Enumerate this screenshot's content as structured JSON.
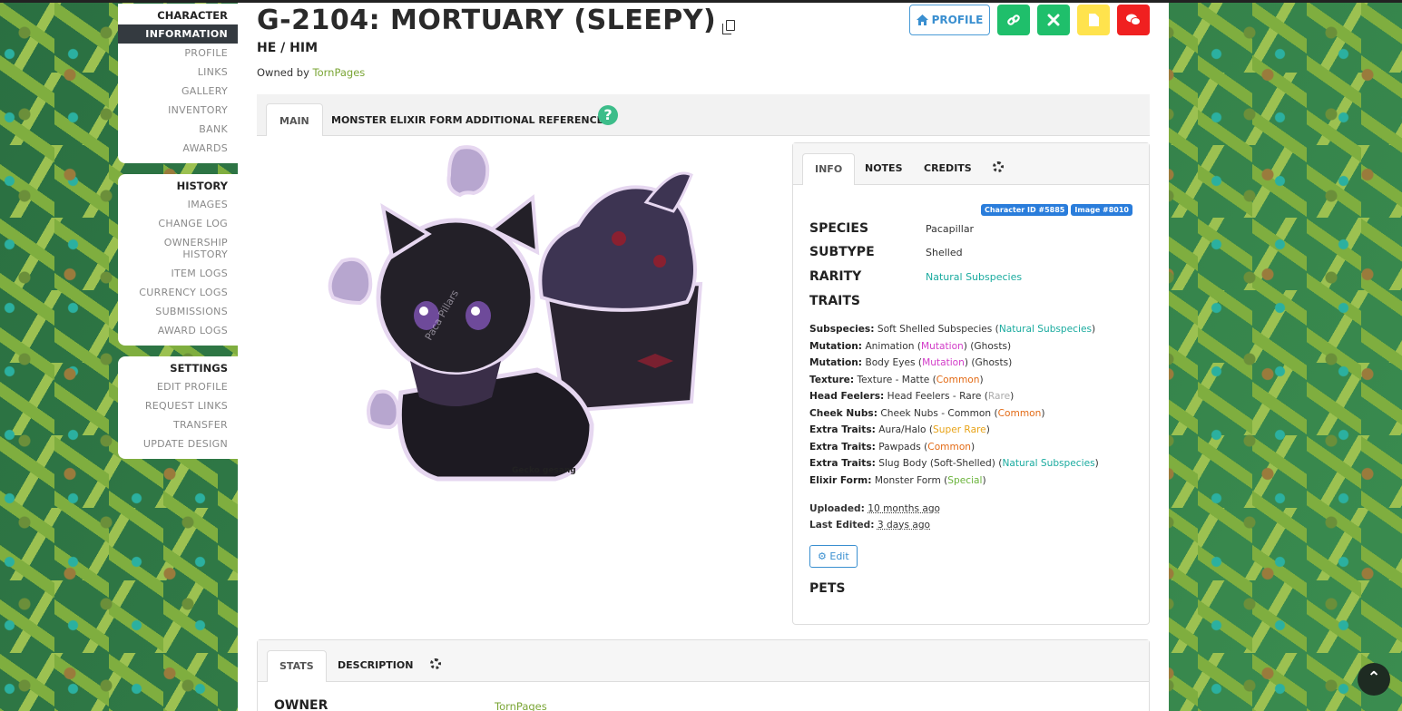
{
  "sidebar": {
    "sections": [
      {
        "heading": "CHARACTER",
        "items": [
          "INFORMATION",
          "PROFILE",
          "LINKS",
          "GALLERY",
          "INVENTORY",
          "BANK",
          "AWARDS"
        ]
      },
      {
        "heading": "HISTORY",
        "items": [
          "IMAGES",
          "CHANGE LOG",
          "OWNERSHIP HISTORY",
          "ITEM LOGS",
          "CURRENCY LOGS",
          "SUBMISSIONS",
          "AWARD LOGS"
        ]
      },
      {
        "heading": "SETTINGS",
        "items": [
          "EDIT PROFILE",
          "REQUEST LINKS",
          "TRANSFER",
          "UPDATE DESIGN"
        ]
      }
    ],
    "active_item": "INFORMATION"
  },
  "header": {
    "title": "G-2104: MORTUARY (SLEEPY)",
    "pronouns": "HE / HIM",
    "owned_prefix": "Owned by",
    "owner": "TornPages",
    "profile_button": "PROFILE"
  },
  "main_tabs": [
    "MAIN",
    "MONSTER ELIXIR FORM",
    "ADDITIONAL REFERENCE"
  ],
  "art": {
    "signature_text": "Gecko gesang",
    "watermark": "Paca Pillars"
  },
  "info": {
    "tabs": [
      "INFO",
      "NOTES",
      "CREDITS"
    ],
    "character_id": "Character ID #5885",
    "image_id": "Image #8010",
    "species_label": "SPECIES",
    "species": "Pacapillar",
    "subtype_label": "SUBTYPE",
    "subtype": "Shelled",
    "rarity_label": "RARITY",
    "rarity": "Natural Subspecies",
    "traits_label": "TRAITS",
    "traits": [
      {
        "cat": "Subspecies:",
        "name": "Soft Shelled Subspecies",
        "rarity": "Natural Subspecies",
        "color": "teal",
        "extra": ""
      },
      {
        "cat": "Mutation:",
        "name": "Animation",
        "rarity": "Mutation",
        "color": "pink",
        "extra": " (Ghosts)"
      },
      {
        "cat": "Mutation:",
        "name": "Body Eyes",
        "rarity": "Mutation",
        "color": "pink",
        "extra": " (Ghosts)"
      },
      {
        "cat": "Texture:",
        "name": "Texture - Matte",
        "rarity": "Common",
        "color": "orange",
        "extra": ""
      },
      {
        "cat": "Head Feelers:",
        "name": "Head Feelers - Rare",
        "rarity": "Rare",
        "color": "gray",
        "extra": ""
      },
      {
        "cat": "Cheek Nubs:",
        "name": "Cheek Nubs - Common",
        "rarity": "Common",
        "color": "orange",
        "extra": ""
      },
      {
        "cat": "Extra Traits:",
        "name": "Aura/Halo",
        "rarity": "Super Rare",
        "color": "gold",
        "extra": ""
      },
      {
        "cat": "Extra Traits:",
        "name": "Pawpads",
        "rarity": "Common",
        "color": "orange",
        "extra": ""
      },
      {
        "cat": "Extra Traits:",
        "name": "Slug Body (Soft-Shelled)",
        "rarity": "Natural Subspecies",
        "color": "teal",
        "extra": ""
      },
      {
        "cat": "Elixir Form:",
        "name": "Monster Form",
        "rarity": "Special",
        "color": "green",
        "extra": ""
      }
    ],
    "uploaded_label": "Uploaded:",
    "uploaded": "10 months ago",
    "edited_label": "Last Edited:",
    "edited": "3 days ago",
    "edit_button": "Edit",
    "pets_label": "PETS"
  },
  "bottom": {
    "tabs": [
      "STATS",
      "DESCRIPTION"
    ],
    "owner_label": "OWNER",
    "owner": "TornPages"
  },
  "colors": {
    "teal": "#1aab9f",
    "pink": "#d23cc8",
    "orange": "#e36b16",
    "gray": "#aaaaaa",
    "gold": "#e8a317",
    "green": "#6ab33a",
    "accent": "#3a8fd0"
  }
}
